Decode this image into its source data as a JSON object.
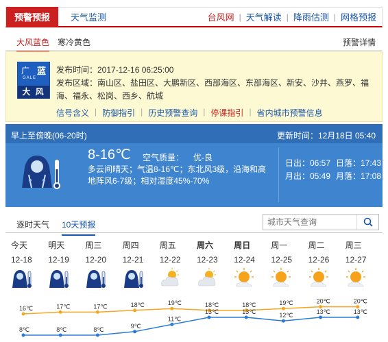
{
  "topnav": {
    "active": "预警预报",
    "left_link": "天气监测",
    "right_links": [
      {
        "label": "台风网",
        "red": true
      },
      {
        "label": "天气解读",
        "red": false
      },
      {
        "label": "降雨估测",
        "red": false
      },
      {
        "label": "网格预报",
        "red": false
      }
    ]
  },
  "warning": {
    "tabs": [
      "大风蓝色",
      "寒冷黄色"
    ],
    "detail_link": "预警详情",
    "sign": {
      "flag": "广",
      "level": "蓝",
      "en": "GALE",
      "cn": "大 风",
      "color": "#1f5fbf"
    },
    "publish_time": "发布时间：2017-12-16 06:25:00",
    "areas": "发布区域：南山区、盐田区、大鹏新区、西部海区、东部海区、新安、沙井、燕罗、福海、福永、松岗、西乡、航城",
    "links": [
      {
        "label": "信号含义",
        "red": false
      },
      {
        "label": "防御指引",
        "red": false
      },
      {
        "label": "历史预警查询",
        "red": false
      },
      {
        "label": "停课指引",
        "red": true
      },
      {
        "label": "省内城市预警信息",
        "red": false
      }
    ]
  },
  "forecast": {
    "period": "早上至傍晚(06-20时)",
    "update": "更新时间：12月18日 05:40",
    "temp": "8-16℃",
    "aq_label": "空气质量：",
    "aq_value": "优-良",
    "desc": "多云间晴天；气温8-16℃；东北风3级，沿海和高地阵风6-7级；相对湿度45%-70%",
    "sunrise": "日出：06:57",
    "sunset": "日落：17:43",
    "moonrise": "月出：05:49",
    "moonset": "月落：17:08"
  },
  "tabs2": {
    "items": [
      "逐时天气",
      "10天预报"
    ],
    "search_placeholder": "城市天气查询"
  },
  "days": [
    {
      "name": "今天",
      "date": "12-18",
      "icon": "cold-rain-icon",
      "bold": false
    },
    {
      "name": "明天",
      "date": "12-19",
      "icon": "cold-rain-icon",
      "bold": false
    },
    {
      "name": "周三",
      "date": "12-20",
      "icon": "cold-rain-icon",
      "bold": false
    },
    {
      "name": "周四",
      "date": "12-21",
      "icon": "cold-rain-icon",
      "bold": false
    },
    {
      "name": "周五",
      "date": "12-22",
      "icon": "partly-cloudy-icon",
      "bold": false
    },
    {
      "name": "周六",
      "date": "12-23",
      "icon": "partly-cloudy-icon",
      "bold": true
    },
    {
      "name": "周日",
      "date": "12-24",
      "icon": "sunny-cloud-icon",
      "bold": true
    },
    {
      "name": "周一",
      "date": "12-25",
      "icon": "sunny-cloud-icon",
      "bold": false
    },
    {
      "name": "周二",
      "date": "12-26",
      "icon": "sunny-cloud-icon",
      "bold": false
    },
    {
      "name": "周三",
      "date": "12-27",
      "icon": "sunny-cloud-icon",
      "bold": false
    }
  ],
  "chart_data": {
    "type": "line",
    "x": [
      "12-18",
      "12-19",
      "12-20",
      "12-21",
      "12-22",
      "12-23",
      "12-24",
      "12-25",
      "12-26",
      "12-27"
    ],
    "series": [
      {
        "values": [
          16,
          17,
          17,
          18,
          19,
          18,
          18,
          19,
          20,
          20
        ],
        "color": "#f5a623"
      },
      {
        "values": [
          8,
          8,
          8,
          9,
          11,
          13,
          13,
          12,
          13,
          13
        ],
        "color": "#2b7bd6"
      }
    ],
    "unit": "℃"
  }
}
